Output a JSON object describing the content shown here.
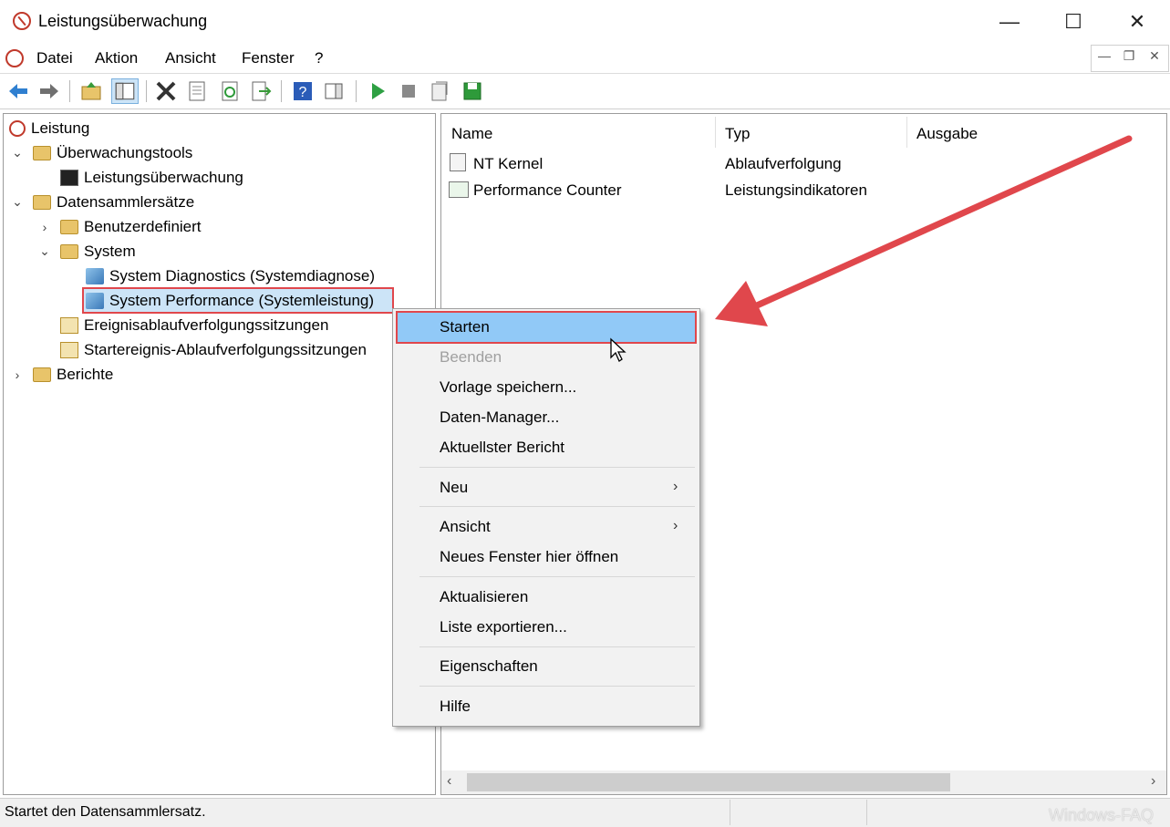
{
  "window": {
    "title": "Leistungsüberwachung"
  },
  "menubar": {
    "items": [
      "Datei",
      "Aktion",
      "Ansicht",
      "Fenster",
      "?"
    ]
  },
  "tree": {
    "root": "Leistung",
    "items": [
      {
        "label": "Überwachungstools"
      },
      {
        "label": "Leistungsüberwachung"
      },
      {
        "label": "Datensammlersätze"
      },
      {
        "label": "Benutzerdefiniert"
      },
      {
        "label": "System"
      },
      {
        "label": "System Diagnostics (Systemdiagnose)"
      },
      {
        "label": "System Performance (Systemleistung)"
      },
      {
        "label": "Ereignisablaufverfolgungssitzungen"
      },
      {
        "label": "Startereignis-Ablaufverfolgungssitzungen"
      },
      {
        "label": "Berichte"
      }
    ]
  },
  "list": {
    "columns": [
      "Name",
      "Typ",
      "Ausgabe"
    ],
    "rows": [
      {
        "name": "NT Kernel",
        "type": "Ablaufverfolgung",
        "output": ""
      },
      {
        "name": "Performance Counter",
        "type": "Leistungsindikatoren",
        "output": ""
      }
    ]
  },
  "context_menu": {
    "items": [
      "Starten",
      "Beenden",
      "Vorlage speichern...",
      "Daten-Manager...",
      "Aktuellster Bericht",
      "Neu",
      "Ansicht",
      "Neues Fenster hier öffnen",
      "Aktualisieren",
      "Liste exportieren...",
      "Eigenschaften",
      "Hilfe"
    ]
  },
  "status": {
    "text": "Startet den Datensammlersatz.",
    "watermark": "Windows-FAQ"
  },
  "colors": {
    "highlight": "#91c9f7",
    "annotation_red": "#e0474c"
  }
}
